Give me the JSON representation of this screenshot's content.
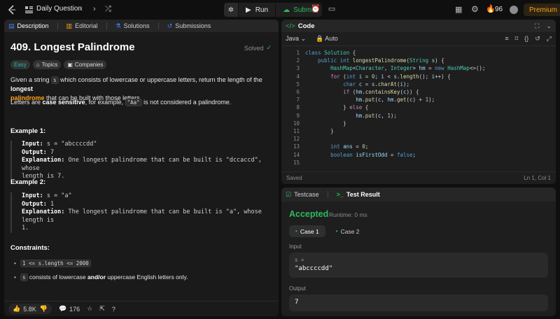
{
  "topbar": {
    "title": "Daily Question",
    "run_label": "Run",
    "submit_label": "Submit",
    "streak": "96",
    "premium_label": "Premium"
  },
  "left": {
    "tabs": [
      "Description",
      "Editorial",
      "Solutions",
      "Submissions"
    ],
    "problem_title": "409. Longest Palindrome",
    "solved_label": "Solved",
    "badges": [
      "Easy",
      "Topics",
      "Companies"
    ],
    "desc_p1": {
      "t1": "Given a string ",
      "c1": "s",
      "t2": " which consists of lowercase or uppercase letters, return the length of the ",
      "b1": "longest",
      "h1": "palindrome",
      "t3": " that can be built with those letters."
    },
    "desc_p2": {
      "t1": "Letters are ",
      "b1": "case sensitive",
      "t2": ", for example, ",
      "c1": "\"Aa\"",
      "t3": " is not considered a palindrome."
    },
    "example1": {
      "title": "Example 1:",
      "input_k": "Input:",
      "input_v": " s = \"abccccdd\"",
      "output_k": "Output:",
      "output_v": " 7",
      "expl_k": "Explanation:",
      "expl_v1": " One longest palindrome that can be built is \"dccaccd\", whose",
      "expl_v2": "length is 7."
    },
    "example2": {
      "title": "Example 2:",
      "input_k": "Input:",
      "input_v": " s = \"a\"",
      "output_k": "Output:",
      "output_v": " 1",
      "expl_k": "Explanation:",
      "expl_v1": " The longest palindrome that can be built is \"a\", whose length is",
      "expl_v2": "1."
    },
    "constraints_title": "Constraints:",
    "constraint1": "1 <= s.length <= 2000",
    "constraint2": {
      "c1": "s",
      "t1": " consists of lowercase ",
      "b1": "and/or",
      "t2": " uppercase English letters only."
    },
    "footer": {
      "likes": "5.8K",
      "comments": "176"
    }
  },
  "code": {
    "header": "Code",
    "language": "Java",
    "auto_label": "Auto",
    "line_numbers": [
      "1",
      "2",
      "3",
      "4",
      "5",
      "6",
      "7",
      "8",
      "9",
      "10",
      "11",
      "12",
      "13",
      "14",
      "15",
      "16"
    ],
    "status_left": "Saved",
    "status_right": "Ln 1, Col 1"
  },
  "result": {
    "tab_testcase": "Testcase",
    "tab_result": "Test Result",
    "verdict": "Accepted",
    "runtime": "Runtime: 0 ms",
    "case1": "Case 1",
    "case2": "Case 2",
    "input_label": "Input",
    "input_name": "s =",
    "input_value": "\"abccccdd\"",
    "output_label": "Output",
    "output_value": "7"
  },
  "colors": {
    "accent_green": "#2cbb5d",
    "accent_orange": "#ffa116",
    "easy": "#1cbaba"
  },
  "icons": {
    "topbar": [
      "logo-icon",
      "list-icon",
      "chevron-left-icon",
      "chevron-right-icon",
      "shuffle-icon",
      "bug-icon",
      "play-icon",
      "cloud-upload-icon",
      "alarm-icon",
      "note-icon",
      "layout-icon",
      "gear-icon",
      "fire-icon",
      "avatar"
    ],
    "left": [
      "description-icon",
      "editorial-icon",
      "solutions-icon",
      "submissions-icon",
      "tag-icon",
      "lock-icon",
      "check-circle-icon",
      "thumbs-up-icon",
      "thumbs-down-icon",
      "comment-icon",
      "star-icon",
      "share-icon",
      "help-icon"
    ],
    "code": [
      "code-icon",
      "lock-icon",
      "expand-icon",
      "chevron-down-icon",
      "format-icon",
      "bookmark-icon",
      "braces-icon",
      "reset-icon",
      "fullscreen-icon"
    ]
  }
}
